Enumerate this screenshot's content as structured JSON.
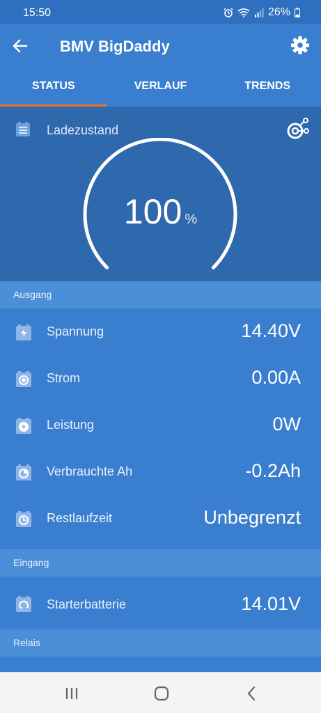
{
  "status_bar": {
    "time": "15:50",
    "battery": "26%",
    "icons": [
      "alarm-icon",
      "wifi-icon",
      "signal-icon",
      "battery-icon"
    ]
  },
  "app_bar": {
    "title": "BMV BigDaddy",
    "back_icon": "arrow-left-icon",
    "settings_icon": "gear-icon"
  },
  "tabs": [
    {
      "label": "STATUS",
      "active": true
    },
    {
      "label": "VERLAUF",
      "active": false
    },
    {
      "label": "TRENDS",
      "active": false
    }
  ],
  "state_of_charge": {
    "label": "Ladezustand",
    "value": "100",
    "unit": "%",
    "level": 1.0
  },
  "sections": {
    "ausgang": "Ausgang",
    "eingang": "Eingang",
    "relais": "Relais"
  },
  "ausgang_rows": [
    {
      "label": "Spannung",
      "value": "14.40V",
      "icon": "battery-bolt-icon"
    },
    {
      "label": "Strom",
      "value": "0.00A",
      "icon": "battery-dot-icon"
    },
    {
      "label": "Leistung",
      "value": "0W",
      "icon": "battery-power-icon"
    },
    {
      "label": "Verbrauchte Ah",
      "value": "-0.2Ah",
      "icon": "battery-consumed-icon"
    },
    {
      "label": "Restlaufzeit",
      "value": "Unbegrenzt",
      "icon": "battery-clock-icon"
    }
  ],
  "eingang_rows": [
    {
      "label": "Starterbatterie",
      "value": "14.01V",
      "icon": "battery-starter-icon"
    }
  ],
  "colors": {
    "primary": "#3a7fcf",
    "header": "#4b8fd9",
    "accent": "#f26d21",
    "gauge_bg": "#2e68ad"
  }
}
